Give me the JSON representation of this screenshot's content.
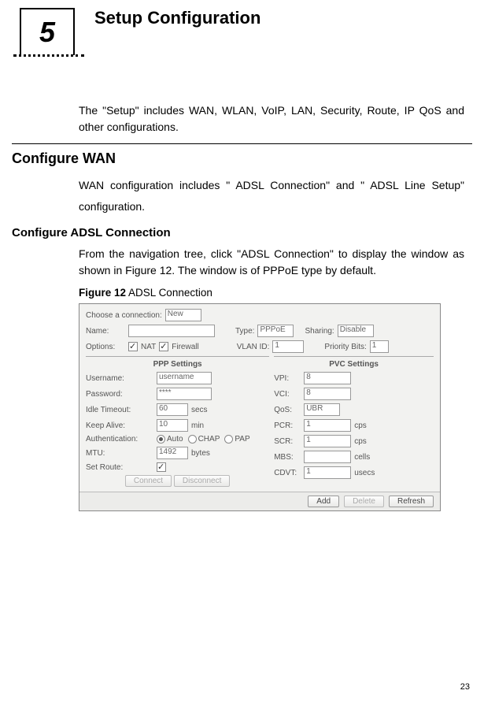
{
  "chapter": {
    "number": "5",
    "title": "Setup Configuration"
  },
  "intro": "The \"Setup\" includes WAN, WLAN, VoIP, LAN, Security, Route, IP QoS and other configurations.",
  "section_h2": "Configure WAN",
  "wan_desc": "WAN configuration includes \" ADSL Connection\"  and \" ADSL Line Setup\" configuration.",
  "section_h3": "Configure ADSL Connection",
  "adsl_desc": "From the navigation tree, click \"ADSL Connection\" to display the window as shown in Figure 12. The window is of PPPoE type by default.",
  "fig_label": "Figure 12",
  "fig_title": "ADSL Connection",
  "fig": {
    "choose_label": "Choose a connection:",
    "choose_value": "New",
    "name_label": "Name:",
    "type_label": "Type:",
    "type_value": "PPPoE",
    "sharing_label": "Sharing:",
    "sharing_value": "Disable",
    "options_label": "Options:",
    "opt_nat": "NAT",
    "opt_fw": "Firewall",
    "vlan_label": "VLAN ID:",
    "vlan_value": "1",
    "prio_label": "Priority Bits:",
    "prio_value": "1",
    "ppp_hdr": "PPP Settings",
    "pvc_hdr": "PVC Settings",
    "ppp": {
      "user_lbl": "Username:",
      "user_val": "username",
      "pass_lbl": "Password:",
      "pass_val": "****",
      "idle_lbl": "Idle Timeout:",
      "idle_val": "60",
      "idle_unit": "secs",
      "keep_lbl": "Keep Alive:",
      "keep_val": "10",
      "keep_unit": "min",
      "auth_lbl": "Authentication:",
      "auth_auto": "Auto",
      "auth_chap": "CHAP",
      "auth_pap": "PAP",
      "mtu_lbl": "MTU:",
      "mtu_val": "1492",
      "mtu_unit": "bytes",
      "route_lbl": "Set Route:"
    },
    "pvc": {
      "vpi_lbl": "VPI:",
      "vpi_val": "8",
      "vci_lbl": "VCI:",
      "vci_val": "8",
      "qos_lbl": "QoS:",
      "qos_val": "UBR",
      "pcr_lbl": "PCR:",
      "pcr_val": "1",
      "pcr_unit": "cps",
      "scr_lbl": "SCR:",
      "scr_val": "1",
      "scr_unit": "cps",
      "mbs_lbl": "MBS:",
      "mbs_val": "",
      "mbs_unit": "cells",
      "cdvt_lbl": "CDVT:",
      "cdvt_val": "1",
      "cdvt_unit": "usecs"
    },
    "mid_connect": "Connect",
    "mid_disconnect": "Disconnect",
    "btn_add": "Add",
    "btn_delete": "Delete",
    "btn_refresh": "Refresh"
  },
  "page_number": "23"
}
